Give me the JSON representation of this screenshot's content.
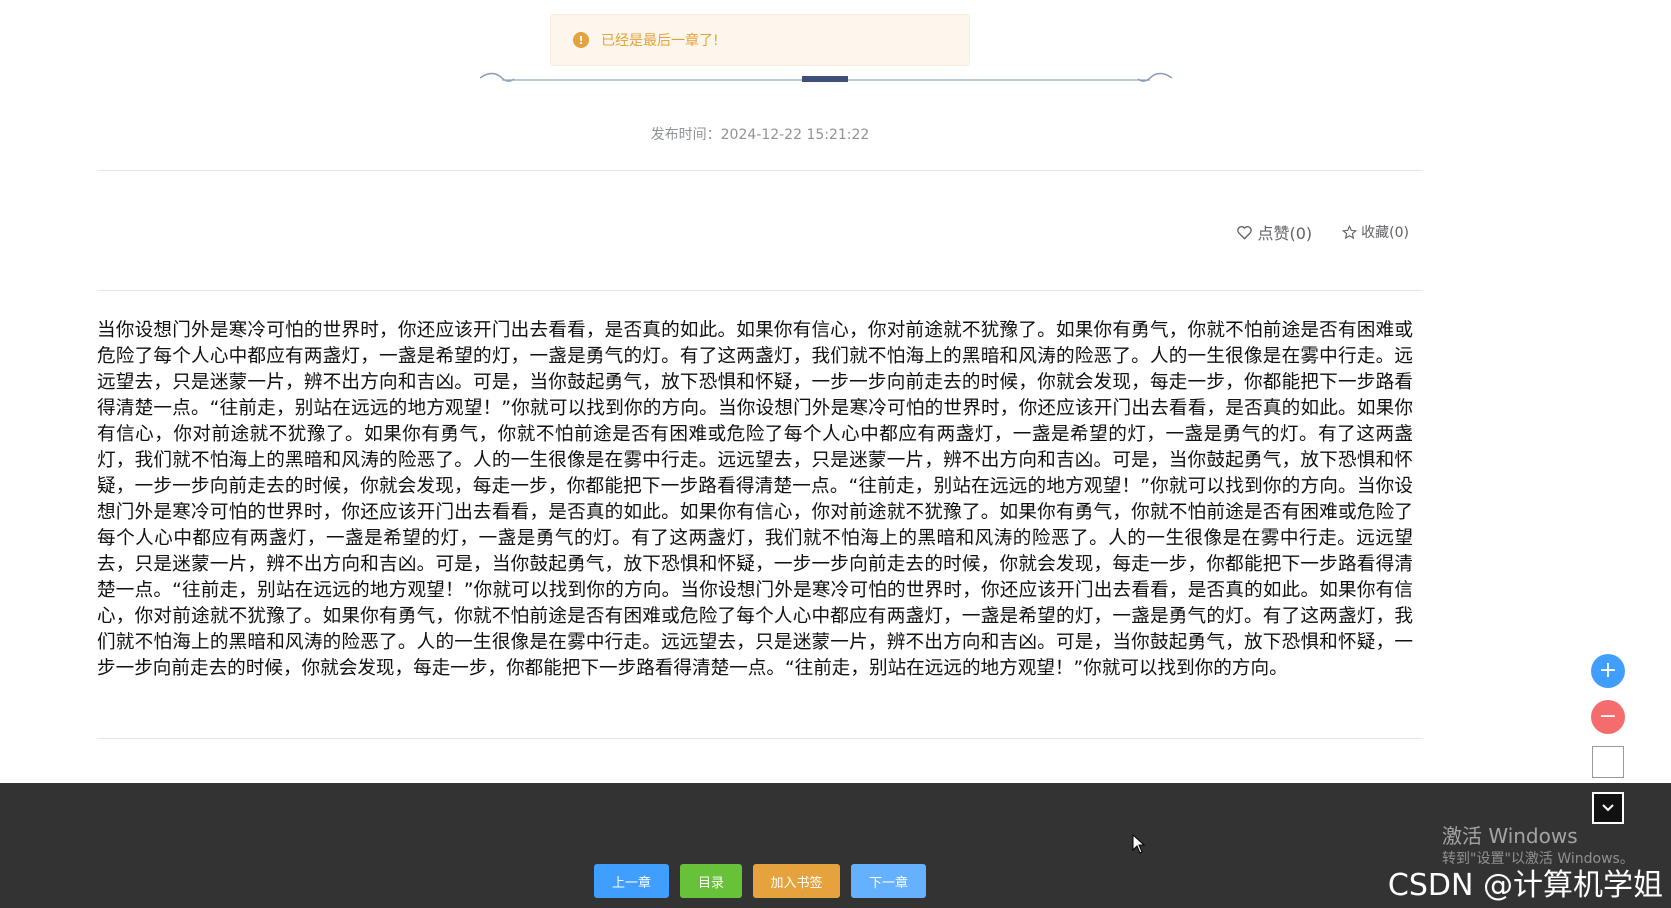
{
  "toast": {
    "icon": "warning-circle-icon",
    "icon_glyph": "!",
    "message": "已经是最后一章了!"
  },
  "meta": {
    "publish_time": "发布时间：2024-12-22 15:21:22"
  },
  "actions": {
    "like_label": "点赞(0)",
    "collect_label": "收藏(0)"
  },
  "content": {
    "text": "当你设想门外是寒冷可怕的世界时，你还应该开门出去看看，是否真的如此。如果你有信心，你对前途就不犹豫了。如果你有勇气，你就不怕前途是否有困难或危险了每个人心中都应有两盏灯，一盏是希望的灯，一盏是勇气的灯。有了这两盏灯，我们就不怕海上的黑暗和风涛的险恶了。人的一生很像是在雾中行走。远远望去，只是迷蒙一片，辨不出方向和吉凶。可是，当你鼓起勇气，放下恐惧和怀疑，一步一步向前走去的时候，你就会发现，每走一步，你都能把下一步路看得清楚一点。“往前走，别站在远远的地方观望！”你就可以找到你的方向。当你设想门外是寒冷可怕的世界时，你还应该开门出去看看，是否真的如此。如果你有信心，你对前途就不犹豫了。如果你有勇气，你就不怕前途是否有困难或危险了每个人心中都应有两盏灯，一盏是希望的灯，一盏是勇气的灯。有了这两盏灯，我们就不怕海上的黑暗和风涛的险恶了。人的一生很像是在雾中行走。远远望去，只是迷蒙一片，辨不出方向和吉凶。可是，当你鼓起勇气，放下恐惧和怀疑，一步一步向前走去的时候，你就会发现，每走一步，你都能把下一步路看得清楚一点。“往前走，别站在远远的地方观望！”你就可以找到你的方向。当你设想门外是寒冷可怕的世界时，你还应该开门出去看看，是否真的如此。如果你有信心，你对前途就不犹豫了。如果你有勇气，你就不怕前途是否有困难或危险了每个人心中都应有两盏灯，一盏是希望的灯，一盏是勇气的灯。有了这两盏灯，我们就不怕海上的黑暗和风涛的险恶了。人的一生很像是在雾中行走。远远望去，只是迷蒙一片，辨不出方向和吉凶。可是，当你鼓起勇气，放下恐惧和怀疑，一步一步向前走去的时候，你就会发现，每走一步，你都能把下一步路看得清楚一点。“往前走，别站在远远的地方观望！”你就可以找到你的方向。当你设想门外是寒冷可怕的世界时，你还应该开门出去看看，是否真的如此。如果你有信心，你对前途就不犹豫了。如果你有勇气，你就不怕前途是否有困难或危险了每个人心中都应有两盏灯，一盏是希望的灯，一盏是勇气的灯。有了这两盏灯，我们就不怕海上的黑暗和风涛的险恶了。人的一生很像是在雾中行走。远远望去，只是迷蒙一片，辨不出方向和吉凶。可是，当你鼓起勇气，放下恐惧和怀疑，一步一步向前走去的时候，你就会发现，每走一步，你都能把下一步路看得清楚一点。“往前走，别站在远远的地方观望！”你就可以找到你的方向。"
  },
  "float_tools": {
    "zoom_in": "+",
    "zoom_out": "−"
  },
  "footer": {
    "prev": "上一章",
    "toc": "目录",
    "bookmark": "加入书签",
    "next": "下一章",
    "colors": {
      "prev": "#409eff",
      "toc": "#67c23a",
      "bookmark": "#e6a23c",
      "next": "#66b1ff",
      "footer_bg": "#333333"
    }
  },
  "overlay": {
    "activate_title": "激活 Windows",
    "activate_sub": "转到\"设置\"以激活 Windows。",
    "csdn": "CSDN @计算机学姐"
  }
}
